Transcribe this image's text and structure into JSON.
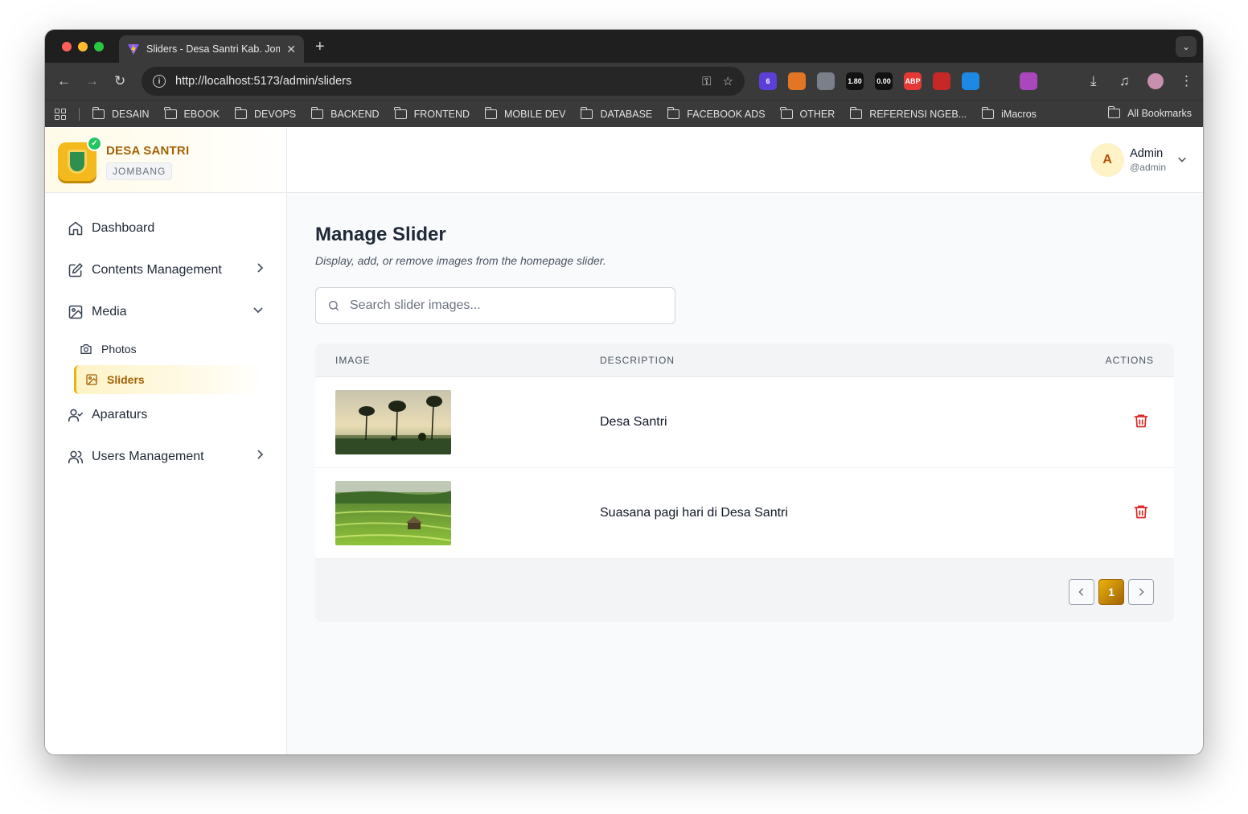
{
  "browser": {
    "tab_title": "Sliders - Desa Santri Kab. Jombang",
    "url": "http://localhost:5173/admin/sliders",
    "extensions": [
      {
        "name": "ext-badge-6",
        "label": "6",
        "color": "#5b3fd6"
      },
      {
        "name": "ext-fox",
        "label": "",
        "color": "#e27625"
      },
      {
        "name": "ext-cloud",
        "label": "",
        "color": "#7a7f8a"
      },
      {
        "name": "ext-metric-1",
        "label": "1.80",
        "color": "#111111"
      },
      {
        "name": "ext-lcp",
        "label": "0.00",
        "color": "#111111"
      },
      {
        "name": "ext-abp",
        "label": "ABP",
        "color": "#e53935"
      },
      {
        "name": "ext-block",
        "label": "",
        "color": "#c62828"
      },
      {
        "name": "ext-doc",
        "label": "",
        "color": "#1e88e5"
      },
      {
        "name": "ext-screenshot",
        "label": "",
        "color": "#3a3a3a"
      },
      {
        "name": "ext-color",
        "label": "",
        "color": "#ab47bc"
      },
      {
        "name": "ext-puzzle",
        "label": "",
        "color": "#3a3a3a"
      }
    ],
    "bookmarks": [
      "DESAIN",
      "EBOOK",
      "DEVOPS",
      "BACKEND",
      "FRONTEND",
      "MOBILE DEV",
      "DATABASE",
      "FACEBOOK ADS",
      "OTHER",
      "REFERENSI NGEB...",
      "iMacros"
    ],
    "all_bookmarks": "All Bookmarks"
  },
  "brand": {
    "name": "DESA SANTRI",
    "region": "JOMBANG"
  },
  "sidebar": {
    "items": [
      {
        "label": "Dashboard",
        "icon": "home-icon"
      },
      {
        "label": "Contents Management",
        "icon": "edit-icon"
      },
      {
        "label": "Media",
        "icon": "image-icon"
      },
      {
        "label": "Photos",
        "icon": "camera-icon"
      },
      {
        "label": "Sliders",
        "icon": "image-icon"
      },
      {
        "label": "Aparaturs",
        "icon": "user-check-icon"
      },
      {
        "label": "Users Management",
        "icon": "users-icon"
      }
    ]
  },
  "user": {
    "initial": "A",
    "name": "Admin",
    "handle": "@admin"
  },
  "page": {
    "title": "Manage Slider",
    "subtitle": "Display, add, or remove images from the homepage slider.",
    "search_placeholder": "Search slider images..."
  },
  "table": {
    "headers": [
      "IMAGE",
      "DESCRIPTION",
      "ACTIONS"
    ],
    "rows": [
      {
        "description": "Desa Santri"
      },
      {
        "description": "Suasana pagi hari di Desa Santri"
      }
    ]
  },
  "pagination": {
    "current_page": "1"
  },
  "colors": {
    "accent": "#a16207",
    "accent_light": "#eab308",
    "danger": "#dc2626"
  }
}
